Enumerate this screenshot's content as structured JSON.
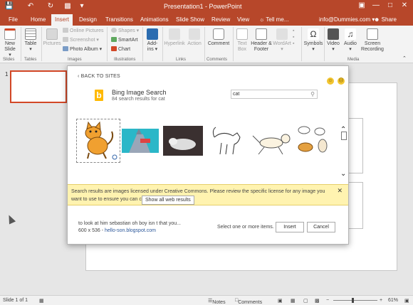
{
  "title_bar": {
    "title": "Presentation1 - PowerPoint",
    "minimize": "—",
    "restore": "□",
    "close": "✕"
  },
  "tabs": [
    "File",
    "Home",
    "Insert",
    "Design",
    "Transitions",
    "Animations",
    "Slide Show",
    "Review",
    "View"
  ],
  "tell_me": "Tell me...",
  "account": "info@Dummies.com ▾",
  "share": "Share",
  "ribbon": {
    "new_slide": "New Slide ▾",
    "table": "Table ▾",
    "pictures": "Pictures",
    "online_pictures": "Online Pictures",
    "screenshot": "Screenshot ▾",
    "photo_album": "Photo Album ▾",
    "shapes": "Shapes ▾",
    "smartart": "SmartArt",
    "chart": "Chart",
    "addins": "Add-ins ▾",
    "hyperlink": "Hyperlink",
    "action": "Action",
    "comment": "Comment",
    "text_box": "Text Box",
    "header_footer": "Header & Footer",
    "wordart": "WordArt ▾",
    "symbols": "Symbols ▾",
    "video": "Video ▾",
    "audio": "Audio ▾",
    "screen_recording": "Screen Recording",
    "groups": {
      "slides": "Slides",
      "tables": "Tables",
      "images": "Images",
      "illustrations": "Illustrations",
      "links": "Links",
      "comments": "Comments",
      "media": "Media"
    }
  },
  "slide_panel": {
    "number": "1"
  },
  "dialog": {
    "back": "‹ BACK TO SITES",
    "source_name": "Bing Image Search",
    "result_count": "84 search results for cat",
    "search_value": "cat",
    "license_text": "Search results are images licensed under Creative Commons. Please review the specific license for any image you want to use to ensure you can comply with it.",
    "show_all": "Show all web results",
    "caption": "to look at him sebastian oh boy isn t that you...",
    "dimensions": "600 x 536 - ",
    "dimensions_link": "hello-son.blogspot.com",
    "select_hint": "Select one or more items.",
    "insert": "Insert",
    "cancel": "Cancel"
  },
  "status_bar": {
    "slide_info": "Slide 1 of 1",
    "notes": "Notes",
    "comments": "Comments",
    "zoom": "61%"
  },
  "colors": {
    "accent": "#b7472a",
    "license_bg": "#fff3b0",
    "link": "#2b579a"
  }
}
